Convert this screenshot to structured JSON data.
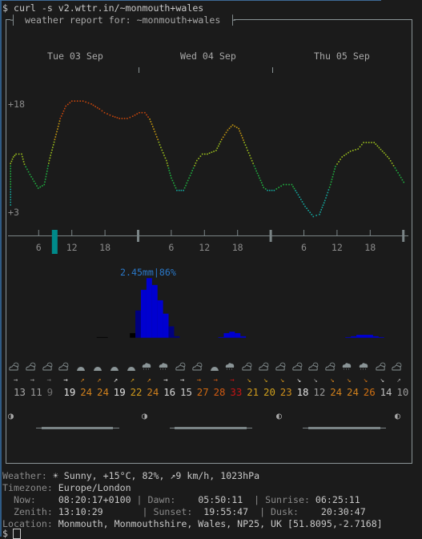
{
  "terminal": {
    "command": "$ curl -s v2.wttr.in/~monmouth+wales",
    "prompt": "$"
  },
  "report": {
    "title": "weather report for: ~monmouth+wales",
    "days": [
      "Tue 03 Sep",
      "Wed 04 Sep",
      "Thu 05 Sep"
    ]
  },
  "chart_data": [
    {
      "type": "line",
      "y_tick_labels": [
        "+18",
        "+3"
      ],
      "x_tick_labels": [
        "6",
        "12",
        "18",
        "6",
        "12",
        "18",
        "6",
        "12",
        "18"
      ],
      "x_ticks_hours": [
        6,
        12,
        18,
        30,
        36,
        42,
        54,
        60,
        66
      ],
      "day_boundaries_hours": [
        24,
        48,
        72
      ],
      "current_hour": 8.9,
      "hours": [
        0.8,
        0.8,
        1.3,
        1.8,
        2.8,
        3.3,
        4.3,
        5.8,
        6.9,
        7.8,
        8.8,
        9.8,
        10.8,
        11.9,
        13.9,
        15.4,
        16.9,
        17.8,
        19.3,
        20.5,
        21.9,
        22.9,
        24.1,
        25.1,
        26.0,
        26.9,
        28.0,
        29.0,
        29.9,
        30.9,
        32.1,
        33.1,
        34.5,
        35.5,
        36.4,
        38.0,
        39.0,
        40.1,
        41.0,
        42.1,
        43.1,
        44.1,
        45.1,
        46.6,
        47.3,
        48.5,
        50.2,
        51.7,
        52.6,
        54.1,
        55.6,
        56.7,
        57.7,
        58.7,
        59.6,
        60.8,
        62.3,
        63.7,
        64.7,
        66.6,
        68.1,
        69.3,
        71.2,
        72.2
      ],
      "temperature_c": [
        4.1,
        9.8,
        10.7,
        11.1,
        11.1,
        9.7,
        8.3,
        6.4,
        6.9,
        10.2,
        13.1,
        16.0,
        17.7,
        18.4,
        18.4,
        18.0,
        17.3,
        16.8,
        16.3,
        16.0,
        16.0,
        16.3,
        16.8,
        16.8,
        15.9,
        14.2,
        12.0,
        10.2,
        7.8,
        6.1,
        6.1,
        7.8,
        10.2,
        11.1,
        11.1,
        11.6,
        13.1,
        14.4,
        15.1,
        14.6,
        12.7,
        10.9,
        9.1,
        6.5,
        6.1,
        6.1,
        6.9,
        6.9,
        5.8,
        3.9,
        2.5,
        2.8,
        4.7,
        6.9,
        9.4,
        10.7,
        11.5,
        11.8,
        12.7,
        12.7,
        11.5,
        10.5,
        8.2,
        6.9
      ],
      "temperature_colors": {
        "hot": "#c8460c",
        "warm": "#c89a10",
        "mild": "#9cc01c",
        "cool": "#20b040",
        "cold": "#14a8a0"
      }
    },
    {
      "type": "bar",
      "max_label": "2.45mm|86%",
      "bars": [
        {
          "hour": 17,
          "mm": 0.02,
          "color": "#000000"
        },
        {
          "hour": 18,
          "mm": 0.02,
          "color": "#000000"
        },
        {
          "hour": 23,
          "mm": 0.19,
          "color": "#000000"
        },
        {
          "hour": 24,
          "mm": 1.12,
          "color": "#00007e"
        },
        {
          "hour": 25,
          "mm": 1.97,
          "color": "#0000d0"
        },
        {
          "hour": 26,
          "mm": 2.45,
          "color": "#0000d0"
        },
        {
          "hour": 27,
          "mm": 2.17,
          "color": "#0000d0"
        },
        {
          "hour": 28,
          "mm": 1.54,
          "color": "#0000d0"
        },
        {
          "hour": 29,
          "mm": 0.99,
          "color": "#0000d0"
        },
        {
          "hour": 30,
          "mm": 0.47,
          "color": "#00007e"
        },
        {
          "hour": 31,
          "mm": 0.06,
          "color": "#00007e"
        },
        {
          "hour": 39,
          "mm": 0.02,
          "color": "#0000d0"
        },
        {
          "hour": 40,
          "mm": 0.19,
          "color": "#0000d0"
        },
        {
          "hour": 41,
          "mm": 0.25,
          "color": "#0000d0"
        },
        {
          "hour": 42,
          "mm": 0.19,
          "color": "#0000d0"
        },
        {
          "hour": 43,
          "mm": 0.06,
          "color": "#0000d0"
        },
        {
          "hour": 62,
          "mm": 0.02,
          "color": "#0000d0"
        },
        {
          "hour": 63,
          "mm": 0.06,
          "color": "#0000d0"
        },
        {
          "hour": 64,
          "mm": 0.12,
          "color": "#0000d0"
        },
        {
          "hour": 65,
          "mm": 0.12,
          "color": "#0000d0"
        },
        {
          "hour": 66,
          "mm": 0.12,
          "color": "#0000d0"
        },
        {
          "hour": 67,
          "mm": 0.06,
          "color": "#0000d0"
        },
        {
          "hour": 68,
          "mm": 0.02,
          "color": "#0000d0"
        }
      ]
    }
  ],
  "conditions": [
    "partly-cloudy",
    "partly-cloudy",
    "partly-cloudy",
    "partly-cloudy",
    "overcast",
    "overcast",
    "overcast",
    "overcast",
    "rain",
    "rain",
    "partly-cloudy",
    "partly-cloudy",
    "overcast",
    "rain",
    "partly-cloudy",
    "partly-cloudy",
    "partly-cloudy",
    "partly-cloudy",
    "partly-cloudy",
    "partly-cloudy",
    "rain",
    "rain",
    "partly-cloudy",
    "partly-cloudy"
  ],
  "wind": [
    {
      "dir": "east",
      "speed": "13",
      "color": "#a8a8a8"
    },
    {
      "dir": "east",
      "speed": "11",
      "color": "#9a9a9a"
    },
    {
      "dir": "east",
      "speed": "9",
      "color": "#6e6e6e"
    },
    {
      "dir": "east",
      "speed": "19",
      "color": "#e2e2e2"
    },
    {
      "dir": "north-east",
      "speed": "24",
      "color": "#d0801c"
    },
    {
      "dir": "north-east",
      "speed": "24",
      "color": "#d0801c"
    },
    {
      "dir": "north-east",
      "speed": "19",
      "color": "#e2e2e2"
    },
    {
      "dir": "north-east",
      "speed": "22",
      "color": "#d09a1c"
    },
    {
      "dir": "north-east",
      "speed": "24",
      "color": "#d0801c"
    },
    {
      "dir": "east",
      "speed": "16",
      "color": "#d8d8d8"
    },
    {
      "dir": "east",
      "speed": "15",
      "color": "#cfcfcf"
    },
    {
      "dir": "east",
      "speed": "27",
      "color": "#d06a12"
    },
    {
      "dir": "east",
      "speed": "28",
      "color": "#d05a12"
    },
    {
      "dir": "east",
      "speed": "33",
      "color": "#c81414"
    },
    {
      "dir": "south-east",
      "speed": "21",
      "color": "#d09a1c"
    },
    {
      "dir": "south-east",
      "speed": "20",
      "color": "#d0a01c"
    },
    {
      "dir": "south-east",
      "speed": "23",
      "color": "#d0901c"
    },
    {
      "dir": "south-east",
      "speed": "18",
      "color": "#e2e2e2"
    },
    {
      "dir": "south-east",
      "speed": "12",
      "color": "#9a9a9a"
    },
    {
      "dir": "south-east",
      "speed": "24",
      "color": "#d0801c"
    },
    {
      "dir": "south-east",
      "speed": "24",
      "color": "#d0801c"
    },
    {
      "dir": "south-east",
      "speed": "26",
      "color": "#d07012"
    },
    {
      "dir": "south-east",
      "speed": "14",
      "color": "#c0c0c0"
    },
    {
      "dir": "north-east",
      "speed": "10",
      "color": "#9a9a9a"
    }
  ],
  "moon_phases": [
    "◑",
    "◑",
    "◐",
    "◐"
  ],
  "info": {
    "weather_label": "Weather:",
    "weather_value": " ☀ Sunny, +15°C, 82%, ↗9 km/h, 1023hPa",
    "timezone_label": "Timezone:",
    "timezone_value": " Europe/London",
    "now_label": "  Now:    ",
    "now_value": "08:20:17+0100",
    "dawn_label": " | Dawn:    ",
    "dawn_value": "05:50:11",
    "sunrise_label": "  | Sunrise: ",
    "sunrise_value": "06:25:11",
    "zenith_label": "  Zenith: ",
    "zenith_value": "13:10:29",
    "sunset_label": "       | Sunset:  ",
    "sunset_value": "19:55:47",
    "dusk_label": "  | Dusk:    ",
    "dusk_value": "20:30:47",
    "location_label": "Location:",
    "location_value": " Monmouth, Monmouthshire, Wales, NP25, UK [51.8095,-2.7168]"
  }
}
